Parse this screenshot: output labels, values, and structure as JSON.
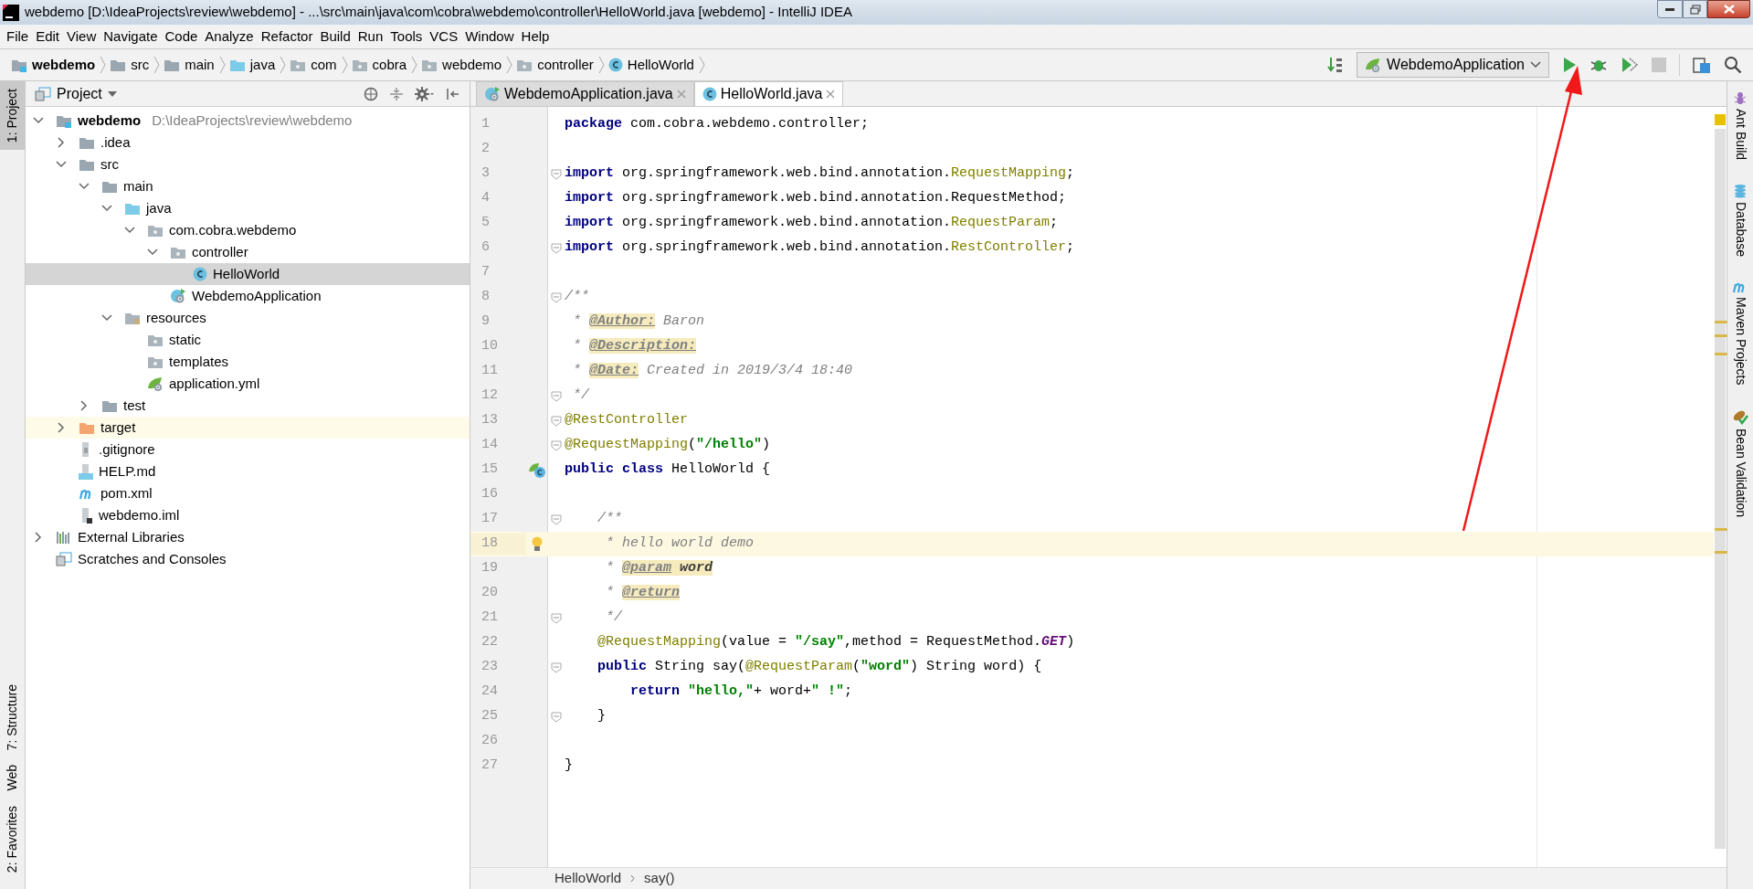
{
  "window": {
    "title": "webdemo [D:\\IdeaProjects\\review\\webdemo] - ...\\src\\main\\java\\com\\cobra\\webdemo\\controller\\HelloWorld.java [webdemo] - IntelliJ IDEA"
  },
  "menu": [
    "File",
    "Edit",
    "View",
    "Navigate",
    "Code",
    "Analyze",
    "Refactor",
    "Build",
    "Run",
    "Tools",
    "VCS",
    "Window",
    "Help"
  ],
  "breadcrumbs": [
    {
      "label": "webdemo",
      "kind": "module"
    },
    {
      "label": "src",
      "kind": "folder"
    },
    {
      "label": "main",
      "kind": "folder"
    },
    {
      "label": "java",
      "kind": "source"
    },
    {
      "label": "com",
      "kind": "package"
    },
    {
      "label": "cobra",
      "kind": "package"
    },
    {
      "label": "webdemo",
      "kind": "package"
    },
    {
      "label": "controller",
      "kind": "package"
    },
    {
      "label": "HelloWorld",
      "kind": "class"
    }
  ],
  "toolbar": {
    "run_config": "WebdemoApplication",
    "stop_disabled": true
  },
  "left_tools": [
    {
      "label": "1: Project",
      "selected": true
    },
    {
      "label": "7: Structure",
      "selected": false
    },
    {
      "label": "Web",
      "selected": false
    },
    {
      "label": "2: Favorites",
      "selected": false
    }
  ],
  "project_panel": {
    "title": "Project",
    "tree": [
      {
        "label": "webdemo",
        "path": "D:\\IdeaProjects\\review\\webdemo",
        "kind": "module",
        "expanded": true,
        "selected": false,
        "children": [
          {
            "label": ".idea",
            "kind": "folder",
            "expanded": false,
            "selected": false
          },
          {
            "label": "src",
            "kind": "folder",
            "expanded": true,
            "selected": false,
            "children": [
              {
                "label": "main",
                "kind": "folder",
                "expanded": true,
                "selected": false,
                "children": [
                  {
                    "label": "java",
                    "kind": "source",
                    "expanded": true,
                    "selected": false,
                    "children": [
                      {
                        "label": "com.cobra.webdemo",
                        "kind": "package",
                        "expanded": true,
                        "selected": false,
                        "children": [
                          {
                            "label": "controller",
                            "kind": "package",
                            "expanded": true,
                            "selected": false,
                            "children": [
                              {
                                "label": "HelloWorld",
                                "kind": "class",
                                "selected": true
                              }
                            ]
                          },
                          {
                            "label": "WebdemoApplication",
                            "kind": "spring-class",
                            "selected": false
                          }
                        ]
                      }
                    ]
                  },
                  {
                    "label": "resources",
                    "kind": "resources",
                    "expanded": true,
                    "selected": false,
                    "children": [
                      {
                        "label": "static",
                        "kind": "package",
                        "selected": false
                      },
                      {
                        "label": "templates",
                        "kind": "package",
                        "selected": false
                      },
                      {
                        "label": "application.yml",
                        "kind": "spring-file",
                        "selected": false
                      }
                    ]
                  }
                ]
              },
              {
                "label": "test",
                "kind": "folder",
                "expanded": false,
                "selected": false
              }
            ]
          },
          {
            "label": "target",
            "kind": "excluded",
            "expanded": false,
            "selected": false,
            "highlighted": true
          },
          {
            "label": ".gitignore",
            "kind": "text",
            "selected": false
          },
          {
            "label": "HELP.md",
            "kind": "markdown",
            "selected": false
          },
          {
            "label": "pom.xml",
            "kind": "maven",
            "selected": false
          },
          {
            "label": "webdemo.iml",
            "kind": "iml",
            "selected": false
          }
        ]
      },
      {
        "label": "External Libraries",
        "kind": "library",
        "expanded": false,
        "selected": false
      },
      {
        "label": "Scratches and Consoles",
        "kind": "scratch",
        "selected": false
      }
    ]
  },
  "tabs": [
    {
      "label": "WebdemoApplication.java",
      "kind": "spring-class",
      "selected": false
    },
    {
      "label": "HelloWorld.java",
      "kind": "class",
      "selected": true
    }
  ],
  "code": [
    {
      "number": "1",
      "tokens": [
        {
          "kind": "kw",
          "text": "package"
        },
        {
          "kind": "plain",
          "text": " com.cobra.webdemo.controller;"
        }
      ]
    },
    {
      "number": "2"
    },
    {
      "number": "3",
      "fold": true,
      "tokens": [
        {
          "kind": "kw",
          "text": "import"
        },
        {
          "kind": "plain",
          "text": " org.springframework.web.bind.annotation."
        },
        {
          "kind": "ann",
          "text": "RequestMapping"
        },
        {
          "kind": "plain",
          "text": ";"
        }
      ]
    },
    {
      "number": "4",
      "tokens": [
        {
          "kind": "kw",
          "text": "import"
        },
        {
          "kind": "plain",
          "text": " org.springframework.web.bind.annotation.RequestMethod;"
        }
      ]
    },
    {
      "number": "5",
      "tokens": [
        {
          "kind": "kw",
          "text": "import"
        },
        {
          "kind": "plain",
          "text": " org.springframework.web.bind.annotation."
        },
        {
          "kind": "ann",
          "text": "RequestParam"
        },
        {
          "kind": "plain",
          "text": ";"
        }
      ]
    },
    {
      "number": "6",
      "fold": true,
      "tokens": [
        {
          "kind": "kw",
          "text": "import"
        },
        {
          "kind": "plain",
          "text": " org.springframework.web.bind.annotation."
        },
        {
          "kind": "ann",
          "text": "RestController"
        },
        {
          "kind": "plain",
          "text": ";"
        }
      ]
    },
    {
      "number": "7"
    },
    {
      "number": "8",
      "fold": true,
      "tokens": [
        {
          "kind": "cmt",
          "text": "/**"
        }
      ]
    },
    {
      "number": "9",
      "tokens": [
        {
          "kind": "cmt",
          "text": " * "
        },
        {
          "kind": "tag",
          "text": "@Author:"
        },
        {
          "kind": "cmt",
          "text": " Baron"
        }
      ]
    },
    {
      "number": "10",
      "tokens": [
        {
          "kind": "cmt",
          "text": " * "
        },
        {
          "kind": "tag",
          "text": "@Description:"
        }
      ]
    },
    {
      "number": "11",
      "tokens": [
        {
          "kind": "cmt",
          "text": " * "
        },
        {
          "kind": "tag",
          "text": "@Date:"
        },
        {
          "kind": "cmt",
          "text": " Created in 2019/3/4 18:40"
        }
      ]
    },
    {
      "number": "12",
      "fold": true,
      "tokens": [
        {
          "kind": "cmt",
          "text": " */"
        }
      ]
    },
    {
      "number": "13",
      "fold": true,
      "tokens": [
        {
          "kind": "ann",
          "text": "@RestController"
        }
      ]
    },
    {
      "number": "14",
      "fold": true,
      "tokens": [
        {
          "kind": "ann",
          "text": "@RequestMapping"
        },
        {
          "kind": "plain",
          "text": "("
        },
        {
          "kind": "str",
          "text": "\"/hello\""
        },
        {
          "kind": "plain",
          "text": ")"
        }
      ]
    },
    {
      "number": "15",
      "gutter": {
        "kind": "bean"
      },
      "tokens": [
        {
          "kind": "kw",
          "text": "public class"
        },
        {
          "kind": "plain",
          "text": " HelloWorld {"
        }
      ]
    },
    {
      "number": "16"
    },
    {
      "number": "17",
      "fold": true,
      "tokens": [
        {
          "kind": "cmt",
          "text": "    /**"
        }
      ]
    },
    {
      "number": "18",
      "current": true,
      "gutter": {
        "kind": "bulb"
      },
      "tokens": [
        {
          "kind": "cmt",
          "text": "     * hello world demo"
        }
      ]
    },
    {
      "number": "19",
      "tokens": [
        {
          "kind": "cmt",
          "text": "     * "
        },
        {
          "kind": "tag",
          "text": "@param"
        },
        {
          "kind": "tagval",
          "text": " word"
        }
      ]
    },
    {
      "number": "20",
      "tokens": [
        {
          "kind": "cmt",
          "text": "     * "
        },
        {
          "kind": "tag",
          "text": "@return"
        }
      ]
    },
    {
      "number": "21",
      "fold": true,
      "tokens": [
        {
          "kind": "cmt",
          "text": "     */"
        }
      ]
    },
    {
      "number": "22",
      "tokens": [
        {
          "kind": "ann",
          "text": "    @RequestMapping"
        },
        {
          "kind": "plain",
          "text": "(value = "
        },
        {
          "kind": "str",
          "text": "\"/say\""
        },
        {
          "kind": "plain",
          "text": ",method = RequestMethod."
        },
        {
          "kind": "const",
          "text": "GET"
        },
        {
          "kind": "plain",
          "text": ")"
        }
      ]
    },
    {
      "number": "23",
      "fold": true,
      "tokens": [
        {
          "kind": "kw",
          "text": "    public"
        },
        {
          "kind": "plain",
          "text": " String say("
        },
        {
          "kind": "ann",
          "text": "@RequestParam"
        },
        {
          "kind": "plain",
          "text": "("
        },
        {
          "kind": "str",
          "text": "\"word\""
        },
        {
          "kind": "plain",
          "text": ") String word) {"
        }
      ]
    },
    {
      "number": "24",
      "tokens": [
        {
          "kind": "kw",
          "text": "        return "
        },
        {
          "kind": "str",
          "text": "\"hello,\""
        },
        {
          "kind": "plain",
          "text": "+ word+"
        },
        {
          "kind": "str",
          "text": "\" !\""
        },
        {
          "kind": "plain",
          "text": ";"
        }
      ]
    },
    {
      "number": "25",
      "fold": true,
      "tokens": [
        {
          "kind": "plain",
          "text": "    }"
        }
      ]
    },
    {
      "number": "26"
    },
    {
      "number": "27",
      "tokens": [
        {
          "kind": "plain",
          "text": "}"
        }
      ]
    }
  ],
  "editor_breadcrumbs": [
    "HelloWorld",
    "say()"
  ],
  "right_tools": [
    {
      "label": "Ant Build",
      "kind": "ant"
    },
    {
      "label": "Database",
      "kind": "database"
    },
    {
      "label": "Maven Projects",
      "kind": "maven"
    },
    {
      "label": "Bean Validation",
      "kind": "bean"
    }
  ]
}
